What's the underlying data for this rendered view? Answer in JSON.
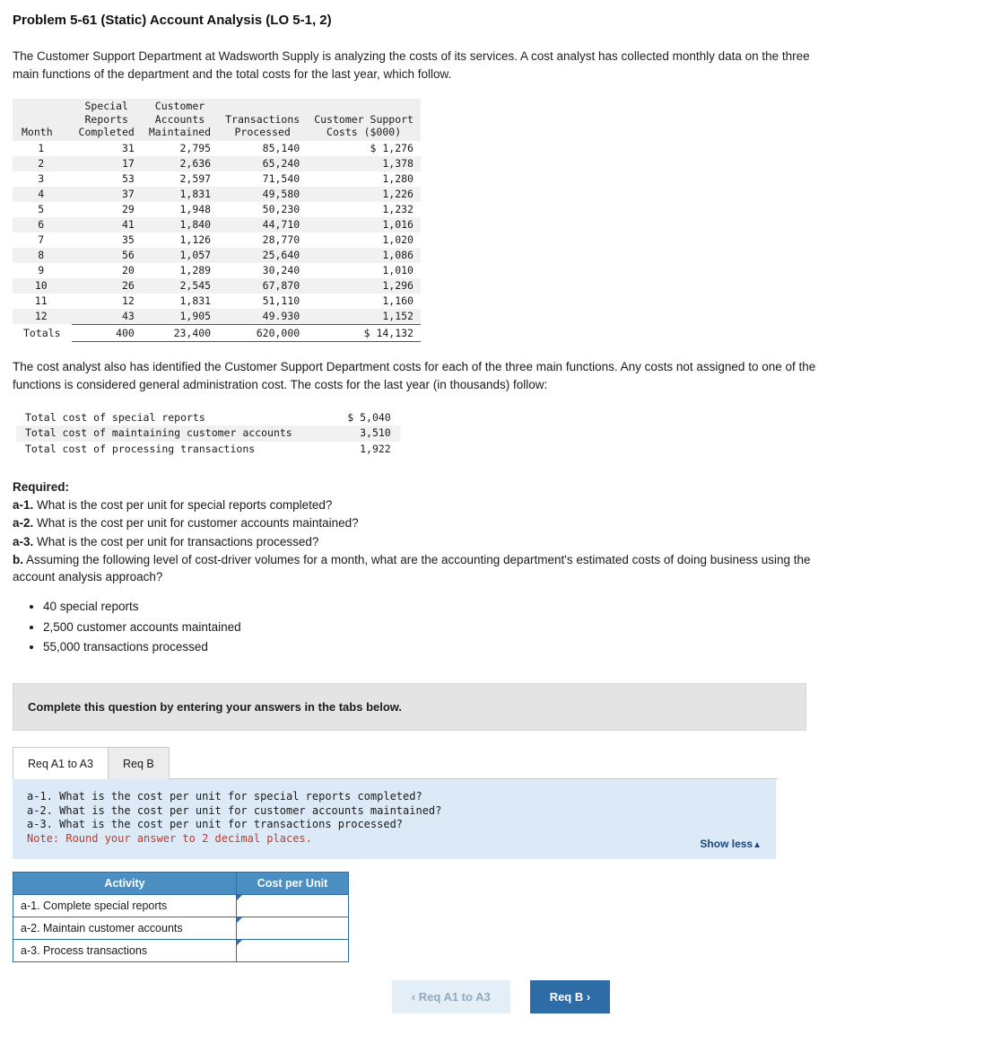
{
  "title": "Problem 5-61 (Static) Account Analysis (LO 5-1, 2)",
  "intro": "The Customer Support Department at Wadsworth Supply is analyzing the costs of its services. A cost analyst has collected monthly data on the three main functions of the department and the total costs for the last year, which follow.",
  "data_table": {
    "headers": [
      "Month",
      "Special\nReports\nCompleted",
      "Customer\nAccounts\nMaintained",
      "Transactions\nProcessed",
      "Customer Support\nCosts ($000)"
    ],
    "header_lines": [
      [
        "Month"
      ],
      [
        "Special",
        "Reports",
        "Completed"
      ],
      [
        "Customer",
        "Accounts",
        "Maintained"
      ],
      [
        "Transactions",
        "Processed"
      ],
      [
        "Customer Support",
        "Costs ($000)"
      ]
    ],
    "rows": [
      [
        "1",
        "31",
        "2,795",
        "85,140",
        "$ 1,276"
      ],
      [
        "2",
        "17",
        "2,636",
        "65,240",
        "1,378"
      ],
      [
        "3",
        "53",
        "2,597",
        "71,540",
        "1,280"
      ],
      [
        "4",
        "37",
        "1,831",
        "49,580",
        "1,226"
      ],
      [
        "5",
        "29",
        "1,948",
        "50,230",
        "1,232"
      ],
      [
        "6",
        "41",
        "1,840",
        "44,710",
        "1,016"
      ],
      [
        "7",
        "35",
        "1,126",
        "28,770",
        "1,020"
      ],
      [
        "8",
        "56",
        "1,057",
        "25,640",
        "1,086"
      ],
      [
        "9",
        "20",
        "1,289",
        "30,240",
        "1,010"
      ],
      [
        "10",
        "26",
        "2,545",
        "67,870",
        "1,296"
      ],
      [
        "11",
        "12",
        "1,831",
        "51,110",
        "1,160"
      ],
      [
        "12",
        "43",
        "1,905",
        "49.930",
        "1,152"
      ]
    ],
    "totals": [
      "Totals",
      "400",
      "23,400",
      "620,000",
      "$ 14,132"
    ]
  },
  "para2": "The cost analyst also has identified the Customer Support Department costs for each of the three main functions. Any costs not assigned to one of the functions is considered general administration cost. The costs for the last year (in thousands) follow:",
  "costs_table": {
    "rows": [
      {
        "label": "Total cost of special reports",
        "value": "$ 5,040"
      },
      {
        "label": "Total cost of maintaining customer accounts",
        "value": "3,510"
      },
      {
        "label": "Total cost of processing transactions",
        "value": "1,922"
      }
    ]
  },
  "required": {
    "heading": "Required:",
    "q_a1_label": "a-1.",
    "q_a1_text": " What is the cost per unit for special reports completed?",
    "q_a2_label": "a-2.",
    "q_a2_text": " What is the cost per unit for customer accounts maintained?",
    "q_a3_label": "a-3.",
    "q_a3_text": " What is the cost per unit for transactions processed?",
    "q_b_label": "b.",
    "q_b_text": " Assuming the following level of cost-driver volumes for a month, what are the accounting department's estimated costs of doing business using the account analysis approach?",
    "bullets": [
      "40 special reports",
      "2,500 customer accounts maintained",
      "55,000 transactions processed"
    ]
  },
  "instruction": "Complete this question by entering your answers in the tabs below.",
  "tabs": [
    {
      "label": "Req A1 to A3",
      "active": true
    },
    {
      "label": "Req B",
      "active": false
    }
  ],
  "blue_panel": {
    "line1": "a-1. What is the cost per unit for special reports completed?",
    "line2": "a-2. What is the cost per unit for customer accounts maintained?",
    "line3": "a-3. What is the cost per unit for transactions processed?",
    "note": "Note: Round your answer to 2 decimal places.",
    "show_less": "Show less",
    "show_less_caret": "▲"
  },
  "answer_table": {
    "col_activity": "Activity",
    "col_cost_per_unit": "Cost per Unit",
    "rows": [
      {
        "activity": "a-1. Complete special reports",
        "value": ""
      },
      {
        "activity": "a-2. Maintain customer accounts",
        "value": ""
      },
      {
        "activity": "a-3. Process transactions",
        "value": ""
      }
    ]
  },
  "nav": {
    "prev_label": "Req A1 to A3",
    "prev_chevron": "‹",
    "next_label": "Req B",
    "next_chevron": "›"
  }
}
